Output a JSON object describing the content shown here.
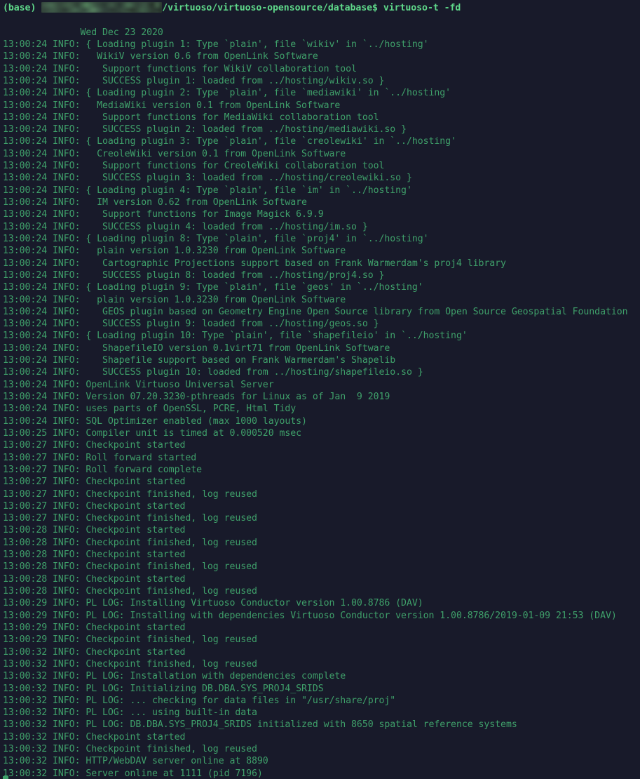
{
  "terminal": {
    "colors": {
      "background": "#181a2a",
      "log_text": "#3fa06a",
      "prompt_text": "#5fd98a",
      "redaction_block": "#2b3a33"
    },
    "prompt": {
      "env": "(base)",
      "redacted_user_host": "",
      "path": "/virtuoso/virtuoso-opensource/database$",
      "command": "virtuoso-t -fd",
      "full_text_visible": "(base)  /virtuoso/virtuoso-opensource/database$ virtuoso-t -fd"
    },
    "banner_date": "              Wed Dec 23 2020",
    "lines": [
      "13:00:24 INFO: { Loading plugin 1: Type `plain', file `wikiv' in `../hosting'",
      "13:00:24 INFO:   WikiV version 0.6 from OpenLink Software",
      "13:00:24 INFO:    Support functions for WikiV collaboration tool",
      "13:00:24 INFO:    SUCCESS plugin 1: loaded from ../hosting/wikiv.so }",
      "13:00:24 INFO: { Loading plugin 2: Type `plain', file `mediawiki' in `../hosting'",
      "13:00:24 INFO:   MediaWiki version 0.1 from OpenLink Software",
      "13:00:24 INFO:    Support functions for MediaWiki collaboration tool",
      "13:00:24 INFO:    SUCCESS plugin 2: loaded from ../hosting/mediawiki.so }",
      "13:00:24 INFO: { Loading plugin 3: Type `plain', file `creolewiki' in `../hosting'",
      "13:00:24 INFO:   CreoleWiki version 0.1 from OpenLink Software",
      "13:00:24 INFO:    Support functions for CreoleWiki collaboration tool",
      "13:00:24 INFO:    SUCCESS plugin 3: loaded from ../hosting/creolewiki.so }",
      "13:00:24 INFO: { Loading plugin 4: Type `plain', file `im' in `../hosting'",
      "13:00:24 INFO:   IM version 0.62 from OpenLink Software",
      "13:00:24 INFO:    Support functions for Image Magick 6.9.9",
      "13:00:24 INFO:    SUCCESS plugin 4: loaded from ../hosting/im.so }",
      "13:00:24 INFO: { Loading plugin 8: Type `plain', file `proj4' in `../hosting'",
      "13:00:24 INFO:   plain version 1.0.3230 from OpenLink Software",
      "13:00:24 INFO:    Cartographic Projections support based on Frank Warmerdam's proj4 library",
      "13:00:24 INFO:    SUCCESS plugin 8: loaded from ../hosting/proj4.so }",
      "13:00:24 INFO: { Loading plugin 9: Type `plain', file `geos' in `../hosting'",
      "13:00:24 INFO:   plain version 1.0.3230 from OpenLink Software",
      "13:00:24 INFO:    GEOS plugin based on Geometry Engine Open Source library from Open Source Geospatial Foundation",
      "13:00:24 INFO:    SUCCESS plugin 9: loaded from ../hosting/geos.so }",
      "13:00:24 INFO: { Loading plugin 10: Type `plain', file `shapefileio' in `../hosting'",
      "13:00:24 INFO:    ShapefileIO version 0.1virt71 from OpenLink Software",
      "13:00:24 INFO:    Shapefile support based on Frank Warmerdam's Shapelib",
      "13:00:24 INFO:    SUCCESS plugin 10: loaded from ../hosting/shapefileio.so }",
      "13:00:24 INFO: OpenLink Virtuoso Universal Server",
      "13:00:24 INFO: Version 07.20.3230-pthreads for Linux as of Jan  9 2019",
      "13:00:24 INFO: uses parts of OpenSSL, PCRE, Html Tidy",
      "13:00:24 INFO: SQL Optimizer enabled (max 1000 layouts)",
      "13:00:25 INFO: Compiler unit is timed at 0.000520 msec",
      "13:00:27 INFO: Checkpoint started",
      "13:00:27 INFO: Roll forward started",
      "13:00:27 INFO: Roll forward complete",
      "13:00:27 INFO: Checkpoint started",
      "13:00:27 INFO: Checkpoint finished, log reused",
      "13:00:27 INFO: Checkpoint started",
      "13:00:27 INFO: Checkpoint finished, log reused",
      "13:00:28 INFO: Checkpoint started",
      "13:00:28 INFO: Checkpoint finished, log reused",
      "13:00:28 INFO: Checkpoint started",
      "13:00:28 INFO: Checkpoint finished, log reused",
      "13:00:28 INFO: Checkpoint started",
      "13:00:28 INFO: Checkpoint finished, log reused",
      "13:00:29 INFO: PL LOG: Installing Virtuoso Conductor version 1.00.8786 (DAV)",
      "13:00:29 INFO: PL LOG: Installing with dependencies Virtuoso Conductor version 1.00.8786/2019-01-09 21:53 (DAV)",
      "13:00:29 INFO: Checkpoint started",
      "13:00:29 INFO: Checkpoint finished, log reused",
      "13:00:32 INFO: Checkpoint started",
      "13:00:32 INFO: Checkpoint finished, log reused",
      "13:00:32 INFO: PL LOG: Installation with dependencies complete",
      "13:00:32 INFO: PL LOG: Initializing DB.DBA.SYS_PROJ4_SRIDS",
      "13:00:32 INFO: PL LOG: ... checking for data files in \"/usr/share/proj\"",
      "13:00:32 INFO: PL LOG: ... using built-in data",
      "13:00:32 INFO: PL LOG: DB.DBA.SYS_PROJ4_SRIDS initialized with 8650 spatial reference systems",
      "13:00:32 INFO: Checkpoint started",
      "13:00:32 INFO: Checkpoint finished, log reused",
      "13:00:32 INFO: HTTP/WebDAV server online at 8890",
      "13:00:32 INFO: Server online at 1111 (pid 7196)"
    ]
  }
}
